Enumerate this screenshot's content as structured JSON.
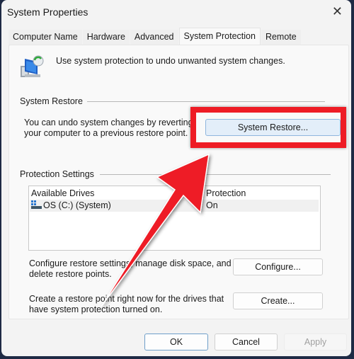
{
  "window": {
    "title": "System Properties",
    "close_icon": "✕"
  },
  "tabs": [
    {
      "label": "Computer Name",
      "active": false
    },
    {
      "label": "Hardware",
      "active": false
    },
    {
      "label": "Advanced",
      "active": false
    },
    {
      "label": "System Protection",
      "active": true
    },
    {
      "label": "Remote",
      "active": false
    }
  ],
  "intro": "Use system protection to undo unwanted system changes.",
  "system_restore": {
    "heading": "System Restore",
    "description_line1": "You can undo system changes by reverting",
    "description_line2": "your computer to a previous restore point.",
    "button": "System Restore..."
  },
  "protection_settings": {
    "heading": "Protection Settings",
    "columns": [
      "Available Drives",
      "Protection"
    ],
    "rows": [
      {
        "drive": "OS (C:) (System)",
        "protection": "On"
      }
    ],
    "configure_text_line1": "Configure restore settings, manage disk space, and",
    "configure_text_line2": "delete restore points.",
    "configure_button": "Configure...",
    "create_text_line1": "Create a restore point right now for the drives that",
    "create_text_line2": "have system protection turned on.",
    "create_button": "Create..."
  },
  "footer": {
    "ok": "OK",
    "cancel": "Cancel",
    "apply": "Apply"
  },
  "annotation": {
    "highlight_color": "#ee1c25"
  }
}
